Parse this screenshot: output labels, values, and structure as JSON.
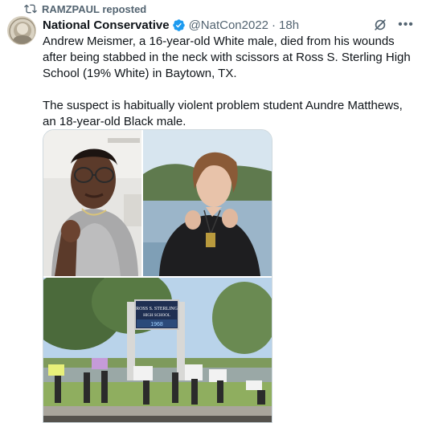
{
  "repost": {
    "label": "RAMZPAUL reposted",
    "icon": "repost-icon"
  },
  "post": {
    "author_name": "National Conservative",
    "handle": "@NatCon2022",
    "separator": "·",
    "time": "18h",
    "text": "Andrew Meismer, a 16-year-old White male, died from his wounds after being stabbed in the neck with scissors at Ross S. Sterling High School (19% White) in Baytown, TX.\n\nThe suspect is habitually violent problem student Aundre Matthews, an 18-year-old Black male."
  },
  "sign": {
    "line1": "ROSS S. STERLING",
    "line2": "HIGH SCHOOL",
    "year": "1968"
  },
  "colors": {
    "text": "#0f1419",
    "secondary": "#536471",
    "verified": "#1d9bf0",
    "border": "#cfd9de"
  }
}
